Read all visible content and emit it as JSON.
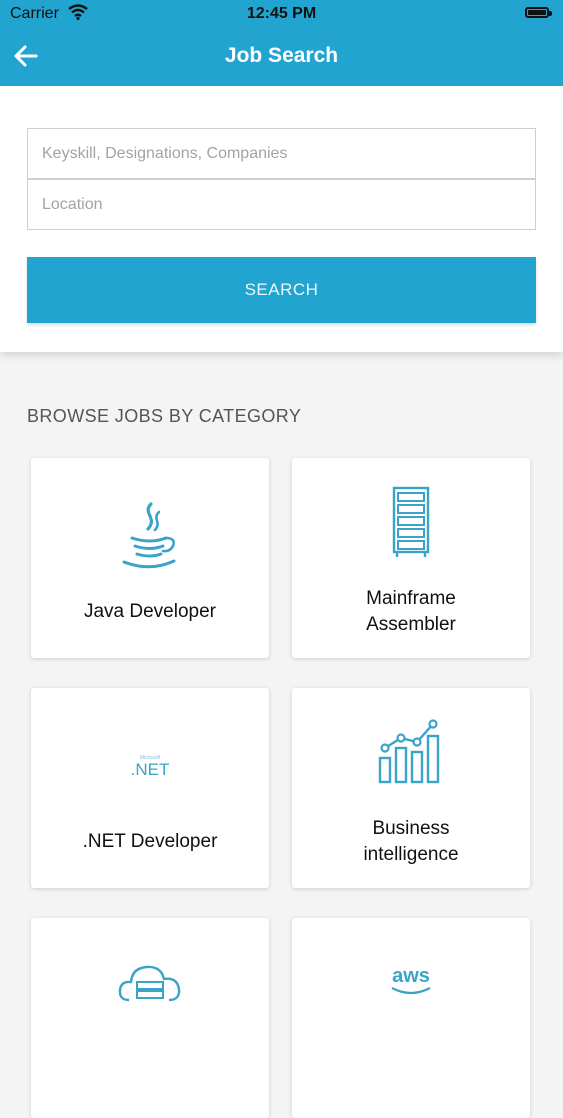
{
  "status_bar": {
    "carrier": "Carrier",
    "time": "12:45 PM"
  },
  "nav": {
    "title": "Job Search"
  },
  "search": {
    "keyskill_placeholder": "Keyskill, Designations, Companies",
    "location_placeholder": "Location",
    "button_label": "SEARCH"
  },
  "browse": {
    "title": "BROWSE JOBS BY CATEGORY",
    "categories": [
      {
        "label": "Java Developer",
        "icon": "java-icon"
      },
      {
        "label": "Mainframe\nAssembler",
        "icon": "server-rack-icon"
      },
      {
        "label": ".NET Developer",
        "icon": "dotnet-icon",
        "icon_text": ".NET",
        "icon_small_text": "Microsoft"
      },
      {
        "label": "Business\nintelligence",
        "icon": "bar-chart-icon"
      },
      {
        "label": "",
        "icon": "cloud-server-icon"
      },
      {
        "label": "",
        "icon": "aws-icon",
        "icon_text": "aws"
      }
    ]
  },
  "colors": {
    "accent": "#22a4d1",
    "background": "#f4f4f4"
  }
}
